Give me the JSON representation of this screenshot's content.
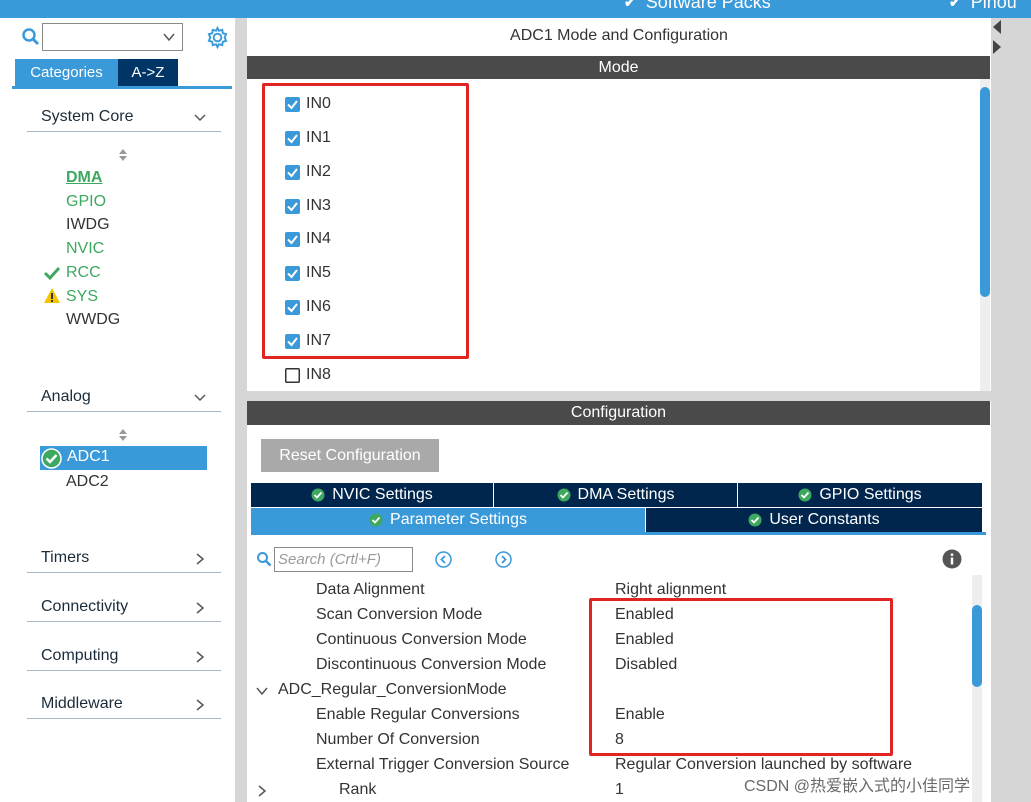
{
  "topbar": {
    "software_packs": "Software Packs",
    "pinout": "Pinou"
  },
  "left": {
    "search": {
      "value": ""
    },
    "tabs": {
      "categories": "Categories",
      "az": "A->Z"
    },
    "groups": {
      "system_core": "System Core",
      "analog": "Analog",
      "timers": "Timers",
      "connectivity": "Connectivity",
      "computing": "Computing",
      "middleware": "Middleware"
    },
    "system_core_items": [
      "DMA",
      "GPIO",
      "IWDG",
      "NVIC",
      "RCC",
      "SYS",
      "WWDG"
    ],
    "analog_items": [
      "ADC1",
      "ADC2"
    ]
  },
  "main": {
    "title": "ADC1 Mode and Configuration",
    "mode_header": "Mode",
    "mode_channels": [
      {
        "label": "IN0",
        "checked": true
      },
      {
        "label": "IN1",
        "checked": true
      },
      {
        "label": "IN2",
        "checked": true
      },
      {
        "label": "IN3",
        "checked": true
      },
      {
        "label": "IN4",
        "checked": true
      },
      {
        "label": "IN5",
        "checked": true
      },
      {
        "label": "IN6",
        "checked": true
      },
      {
        "label": "IN7",
        "checked": true
      },
      {
        "label": "IN8",
        "checked": false
      }
    ],
    "config_header": "Configuration",
    "reset_button": "Reset Configuration",
    "tabs": {
      "nvic": "NVIC Settings",
      "dma": "DMA Settings",
      "gpio": "GPIO Settings",
      "parameter": "Parameter Settings",
      "user_constants": "User Constants"
    },
    "search_placeholder": "Search (Crtl+F)",
    "params": [
      {
        "name": "Data Alignment",
        "value": "Right alignment"
      },
      {
        "name": "Scan Conversion Mode",
        "value": "Enabled"
      },
      {
        "name": "Continuous Conversion Mode",
        "value": "Enabled"
      },
      {
        "name": "Discontinuous Conversion Mode",
        "value": "Disabled"
      },
      {
        "name": "ADC_Regular_ConversionMode",
        "value": ""
      },
      {
        "name": "Enable Regular Conversions",
        "value": "Enable"
      },
      {
        "name": "Number Of Conversion",
        "value": "8"
      },
      {
        "name": "External Trigger Conversion Source",
        "value": "Regular Conversion launched by software"
      },
      {
        "name": "Rank",
        "value": "1"
      }
    ]
  },
  "watermark": "CSDN @热爱嵌入式的小佳同学",
  "colors": {
    "accent": "#3a9ad9",
    "dark_tab": "#00264d",
    "header_bar": "#4a4a4a",
    "green": "#3da85f",
    "highlight_box": "#e02424"
  }
}
